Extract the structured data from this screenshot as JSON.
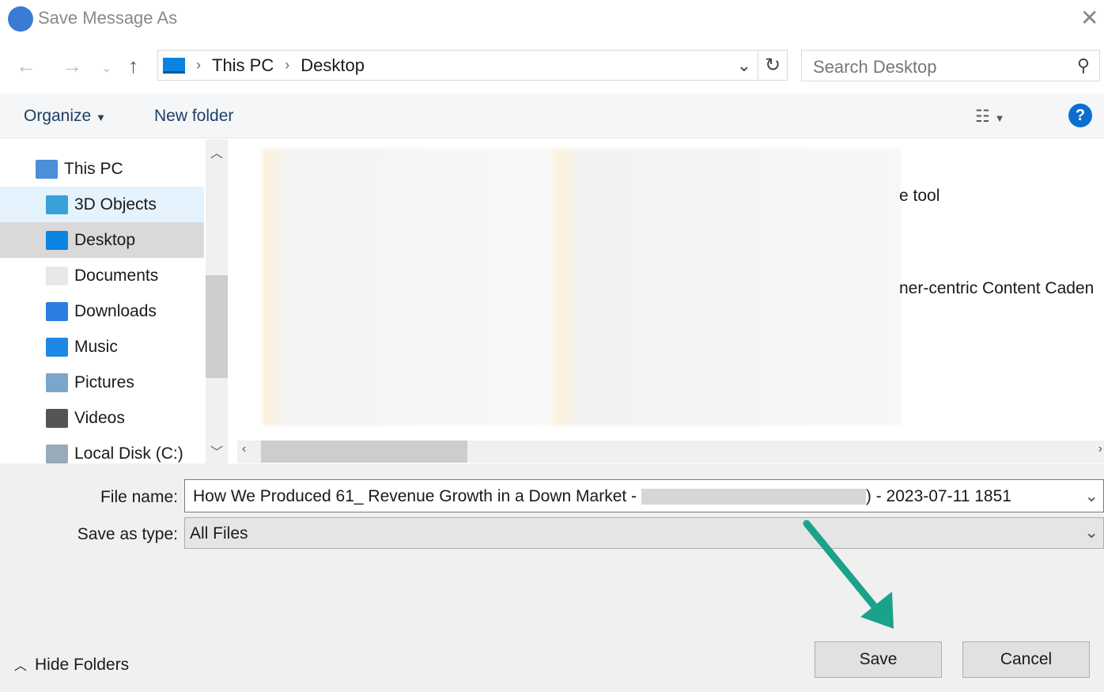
{
  "window": {
    "title": "Save Message As",
    "icon": "thunderbird-icon"
  },
  "nav": {
    "breadcrumb": [
      "This PC",
      "Desktop"
    ],
    "search_placeholder": "Search Desktop"
  },
  "toolbar": {
    "organize": "Organize",
    "new_folder": "New folder",
    "help": "?"
  },
  "tree": [
    {
      "label": "This PC",
      "icon": "computer-icon"
    },
    {
      "label": "3D Objects",
      "icon": "cube-icon"
    },
    {
      "label": "Desktop",
      "icon": "desktop-icon",
      "selected": true
    },
    {
      "label": "Documents",
      "icon": "document-icon"
    },
    {
      "label": "Downloads",
      "icon": "download-icon"
    },
    {
      "label": "Music",
      "icon": "music-icon"
    },
    {
      "label": "Pictures",
      "icon": "picture-icon"
    },
    {
      "label": "Videos",
      "icon": "video-icon"
    },
    {
      "label": "Local Disk (C:)",
      "icon": "disk-icon"
    }
  ],
  "content": {
    "items": [
      "e tool",
      "ner-centric Content Caden"
    ]
  },
  "form": {
    "file_name_label": "File name:",
    "file_name_start": "How We Produced 61_ Revenue Growth in a Down Market - ",
    "file_name_end": ") - 2023-07-11 1851",
    "save_type_label": "Save as type:",
    "save_type": "All Files"
  },
  "buttons": {
    "save": "Save",
    "cancel": "Cancel",
    "hide_folders": "Hide Folders"
  },
  "colors": {
    "accent": "#0078d7",
    "arrow": "#1aa38a"
  }
}
